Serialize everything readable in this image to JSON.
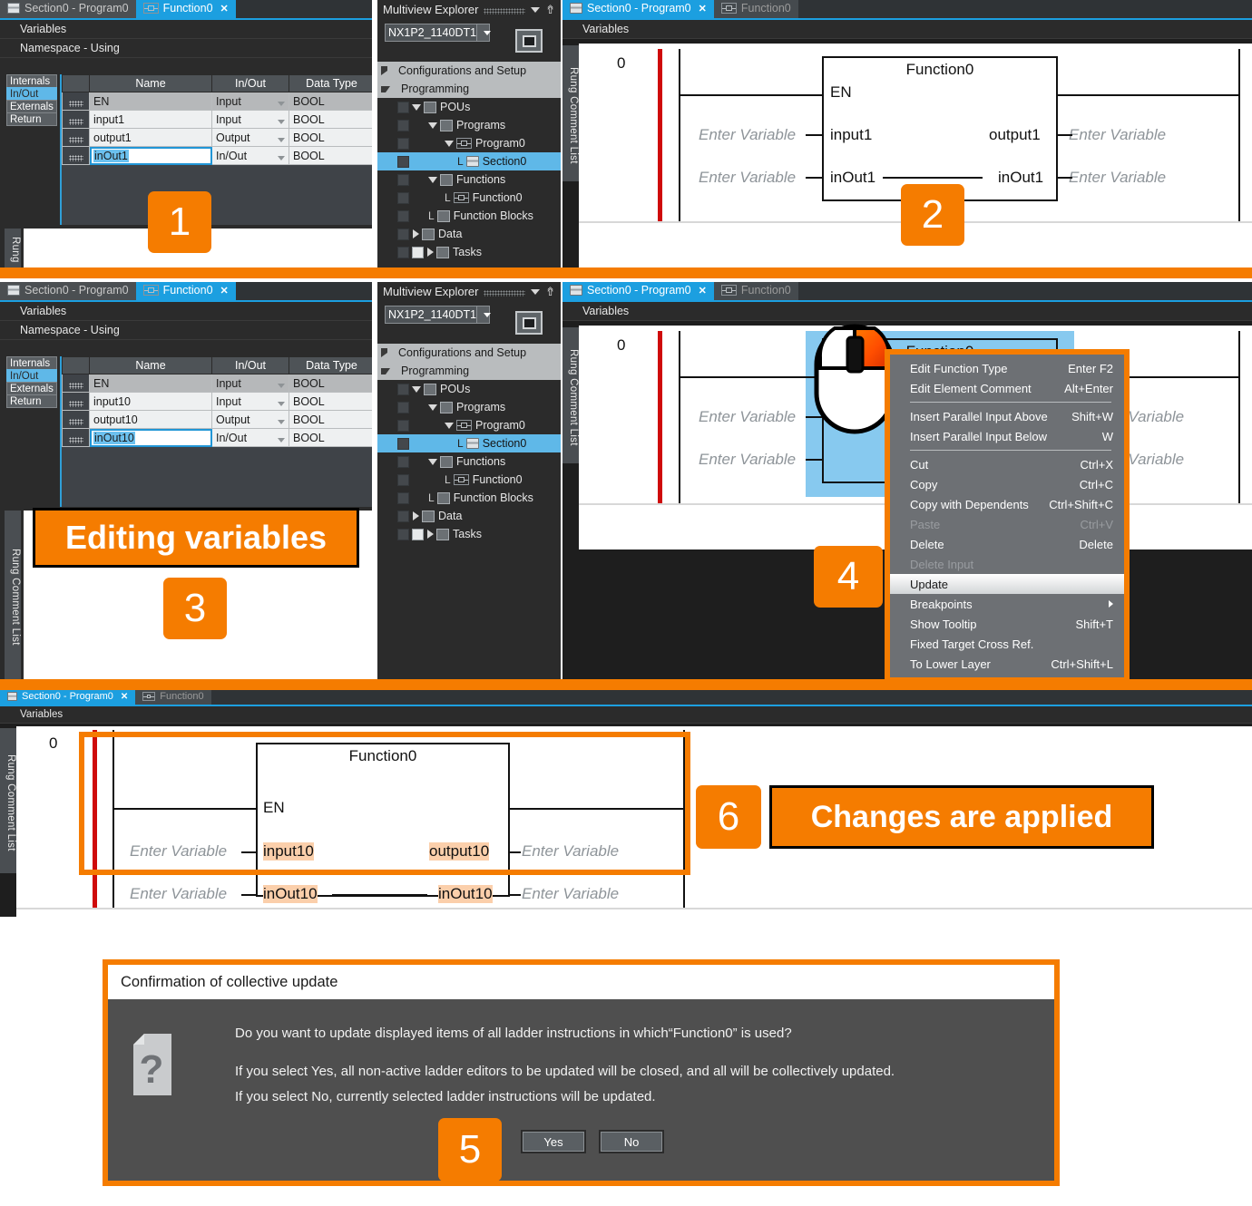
{
  "accent": "#f57c00",
  "tab_active_color": "#1c9fe0",
  "panels": {
    "fn_editor_top": {
      "tabs": [
        {
          "label": "Section0 - Program0",
          "icon": "section-icon",
          "active": false,
          "closable": false
        },
        {
          "label": "Function0",
          "icon": "function-icon",
          "active": true,
          "closable": true
        }
      ],
      "subbar": "Variables",
      "namespace_bar": "Namespace - Using",
      "side_tabs": [
        "Internals",
        "In/Out",
        "Externals",
        "Return"
      ],
      "side_tab_selected": "In/Out",
      "columns": [
        "Name",
        "In/Out",
        "Data Type"
      ],
      "rows": [
        {
          "name": "EN",
          "inout": "Input",
          "type": "BOOL",
          "dim": true,
          "editing": false
        },
        {
          "name": "input1",
          "inout": "Input",
          "type": "BOOL",
          "dim": false,
          "editing": false
        },
        {
          "name": "output1",
          "inout": "Output",
          "type": "BOOL",
          "dim": false,
          "editing": false
        },
        {
          "name": "inOut1",
          "inout": "In/Out",
          "type": "BOOL",
          "dim": false,
          "editing": true
        }
      ],
      "rung_label": "Rung"
    },
    "fn_editor_mid": {
      "tabs": [
        {
          "label": "Section0 - Program0",
          "icon": "section-icon",
          "active": false,
          "closable": false
        },
        {
          "label": "Function0",
          "icon": "function-icon",
          "active": true,
          "closable": true
        }
      ],
      "subbar": "Variables",
      "namespace_bar": "Namespace - Using",
      "side_tabs": [
        "Internals",
        "In/Out",
        "Externals",
        "Return"
      ],
      "side_tab_selected": "In/Out",
      "columns": [
        "Name",
        "In/Out",
        "Data Type"
      ],
      "rows": [
        {
          "name": "EN",
          "inout": "Input",
          "type": "BOOL",
          "dim": true,
          "editing": false
        },
        {
          "name": "input10",
          "inout": "Input",
          "type": "BOOL",
          "dim": false,
          "editing": false
        },
        {
          "name": "output10",
          "inout": "Output",
          "type": "BOOL",
          "dim": false,
          "editing": false
        },
        {
          "name": "inOut10",
          "inout": "In/Out",
          "type": "BOOL",
          "dim": false,
          "editing": true
        }
      ],
      "rung_label": "Rung Comment List"
    },
    "explorer_top": {
      "title": "Multiview Explorer",
      "device": "NX1P2_1140DT1",
      "nodes": [
        {
          "label": "Configurations and Setup",
          "toggle": "right",
          "level": 0,
          "top": true,
          "selected": false,
          "icon": null,
          "hook": false
        },
        {
          "label": "Programming",
          "toggle": "down",
          "level": 0,
          "top": true,
          "selected": false,
          "icon": null,
          "hook": false
        },
        {
          "label": "POUs",
          "toggle": "down",
          "level": 1,
          "top": false,
          "selected": false,
          "icon": "pou-icon",
          "hook": false
        },
        {
          "label": "Programs",
          "toggle": "down",
          "level": 2,
          "top": false,
          "selected": false,
          "icon": "programs-icon",
          "hook": false
        },
        {
          "label": "Program0",
          "toggle": "down",
          "level": 3,
          "top": false,
          "selected": false,
          "icon": "program-icon",
          "hook": false
        },
        {
          "label": "Section0",
          "toggle": "none",
          "level": 4,
          "top": false,
          "selected": true,
          "icon": "section-icon",
          "hook": true
        },
        {
          "label": "Functions",
          "toggle": "down",
          "level": 2,
          "top": false,
          "selected": false,
          "icon": "functions-icon",
          "hook": false
        },
        {
          "label": "Function0",
          "toggle": "none",
          "level": 3,
          "top": false,
          "selected": false,
          "icon": "function-icon",
          "hook": true
        },
        {
          "label": "Function Blocks",
          "toggle": "none",
          "level": 2,
          "top": false,
          "selected": false,
          "icon": "function-block-icon",
          "hook": true
        },
        {
          "label": "Data",
          "toggle": "right",
          "level": 1,
          "top": false,
          "selected": false,
          "icon": "data-icon",
          "hook": false
        },
        {
          "label": "Tasks",
          "toggle": "right",
          "level": 1,
          "top": false,
          "selected": false,
          "icon": "tasks-icon",
          "hook": false
        }
      ]
    },
    "explorer_mid": {
      "title": "Multiview Explorer",
      "device": "NX1P2_1140DT1",
      "nodes": [
        {
          "label": "Configurations and Setup",
          "toggle": "right",
          "level": 0,
          "top": true,
          "selected": false,
          "icon": null,
          "hook": false
        },
        {
          "label": "Programming",
          "toggle": "down",
          "level": 0,
          "top": true,
          "selected": false,
          "icon": null,
          "hook": false
        },
        {
          "label": "POUs",
          "toggle": "down",
          "level": 1,
          "top": false,
          "selected": false,
          "icon": "pou-icon",
          "hook": false
        },
        {
          "label": "Programs",
          "toggle": "down",
          "level": 2,
          "top": false,
          "selected": false,
          "icon": "programs-icon",
          "hook": false
        },
        {
          "label": "Program0",
          "toggle": "down",
          "level": 3,
          "top": false,
          "selected": false,
          "icon": "program-icon",
          "hook": false
        },
        {
          "label": "Section0",
          "toggle": "none",
          "level": 4,
          "top": false,
          "selected": true,
          "icon": "section-icon",
          "hook": true
        },
        {
          "label": "Functions",
          "toggle": "down",
          "level": 2,
          "top": false,
          "selected": false,
          "icon": "functions-icon",
          "hook": false
        },
        {
          "label": "Function0",
          "toggle": "none",
          "level": 3,
          "top": false,
          "selected": false,
          "icon": "function-icon",
          "hook": true
        },
        {
          "label": "Function Blocks",
          "toggle": "none",
          "level": 2,
          "top": false,
          "selected": false,
          "icon": "function-block-icon",
          "hook": true
        },
        {
          "label": "Data",
          "toggle": "right",
          "level": 1,
          "top": false,
          "selected": false,
          "icon": "data-icon",
          "hook": false
        },
        {
          "label": "Tasks",
          "toggle": "right",
          "level": 1,
          "top": false,
          "selected": false,
          "icon": "tasks-icon",
          "hook": false
        }
      ]
    },
    "ladder_top": {
      "tabs": [
        {
          "label": "Section0 - Program0",
          "icon": "section-icon",
          "active": true,
          "closable": true
        },
        {
          "label": "Function0",
          "icon": "function-icon",
          "active": false,
          "closable": false
        }
      ],
      "subbar": "Variables",
      "rung_label": "Rung Comment List",
      "rung_number": "0",
      "block_title": "Function0",
      "en_label": "EN",
      "left_pins": [
        "input1",
        "inOut1"
      ],
      "right_pins": [
        "output1",
        "inOut1"
      ],
      "placeholder": "Enter Variable"
    },
    "ladder_mid": {
      "tabs": [
        {
          "label": "Section0 - Program0",
          "icon": "section-icon",
          "active": true,
          "closable": true
        },
        {
          "label": "Function0",
          "icon": "function-icon",
          "active": false,
          "closable": false
        }
      ],
      "subbar": "Variables",
      "rung_label": "Rung Comment List",
      "rung_number": "0",
      "block_title": "Function0",
      "placeholder": "Enter Variable"
    },
    "ladder_bottom": {
      "tabs": [
        {
          "label": "Section0 - Program0",
          "icon": "section-icon",
          "active": true,
          "closable": true
        },
        {
          "label": "Function0",
          "icon": "function-icon",
          "active": false,
          "closable": false
        }
      ],
      "subbar": "Variables",
      "rung_label": "Rung Comment List",
      "rung_number": "0",
      "block_title": "Function0",
      "en_label": "EN",
      "left_pins": [
        "input10",
        "inOut10"
      ],
      "right_pins": [
        "output10",
        "inOut10"
      ],
      "placeholder": "Enter Variable"
    }
  },
  "context_menu": {
    "items": [
      {
        "label": "Edit Function Type",
        "key": "Enter F2",
        "disabled": false,
        "highlight": false,
        "submenu": false
      },
      {
        "label": "Edit Element Comment",
        "key": "Alt+Enter",
        "disabled": false,
        "highlight": false,
        "submenu": false
      },
      {
        "sep": true
      },
      {
        "label": "Insert Parallel Input Above",
        "key": "Shift+W",
        "disabled": false,
        "highlight": false,
        "submenu": false
      },
      {
        "label": "Insert Parallel Input Below",
        "key": "W",
        "disabled": false,
        "highlight": false,
        "submenu": false
      },
      {
        "sep": true
      },
      {
        "label": "Cut",
        "key": "Ctrl+X",
        "disabled": false,
        "highlight": false,
        "submenu": false
      },
      {
        "label": "Copy",
        "key": "Ctrl+C",
        "disabled": false,
        "highlight": false,
        "submenu": false
      },
      {
        "label": "Copy with Dependents",
        "key": "Ctrl+Shift+C",
        "disabled": false,
        "highlight": false,
        "submenu": false
      },
      {
        "label": "Paste",
        "key": "Ctrl+V",
        "disabled": true,
        "highlight": false,
        "submenu": false
      },
      {
        "label": "Delete",
        "key": "Delete",
        "disabled": false,
        "highlight": false,
        "submenu": false
      },
      {
        "label": "Delete Input",
        "key": "",
        "disabled": true,
        "highlight": false,
        "submenu": false
      },
      {
        "label": "Update",
        "key": "",
        "disabled": false,
        "highlight": true,
        "submenu": false
      },
      {
        "label": "Breakpoints",
        "key": "",
        "disabled": false,
        "highlight": false,
        "submenu": true
      },
      {
        "label": "Show Tooltip",
        "key": "Shift+T",
        "disabled": false,
        "highlight": false,
        "submenu": false
      },
      {
        "label": "Fixed Target Cross Ref.",
        "key": "",
        "disabled": false,
        "highlight": false,
        "submenu": false
      },
      {
        "label": "To Lower Layer",
        "key": "Ctrl+Shift+L",
        "disabled": false,
        "highlight": false,
        "submenu": false
      }
    ]
  },
  "dialog": {
    "title": "Confirmation of collective update",
    "line1": "Do you want to update displayed items of all ladder instructions in which“Function0” is used?",
    "line2": "If you select Yes, all non-active ladder editors to be updated will be closed, and all will be collectively updated.",
    "line3": "If you select No, currently selected ladder instructions will be updated.",
    "yes": "Yes",
    "no": "No"
  },
  "annotations": {
    "step1": "1",
    "step2": "2",
    "step3": "3",
    "step4": "4",
    "step5": "5",
    "step6": "6",
    "editing_variables": "Editing variables",
    "changes_applied": "Changes are applied"
  }
}
